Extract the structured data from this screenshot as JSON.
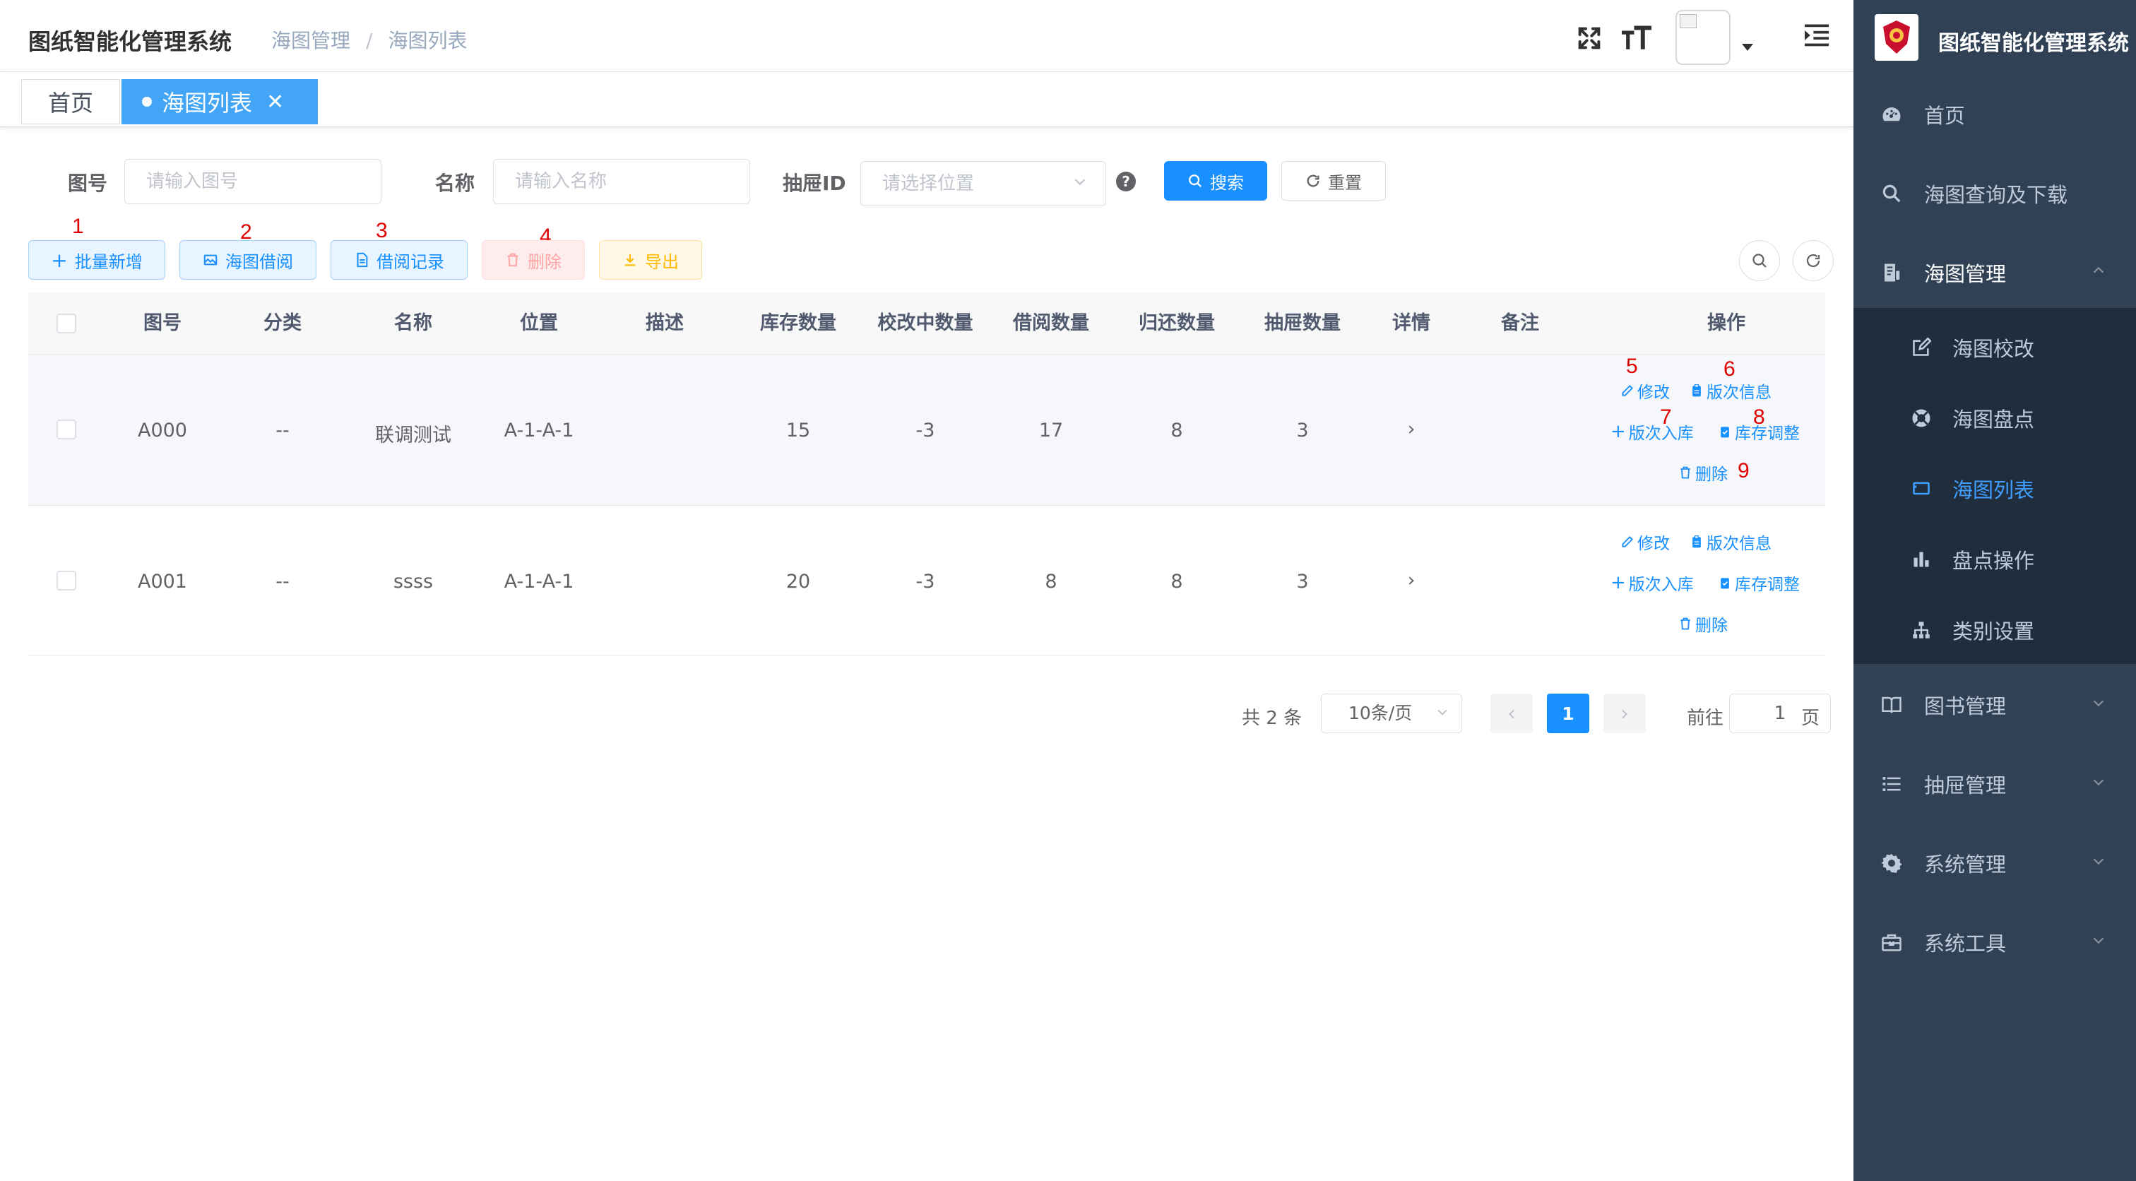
{
  "header": {
    "app_title": "图纸智能化管理系统",
    "breadcrumb": [
      "海图管理",
      "海图列表"
    ],
    "breadcrumb_sep": "/"
  },
  "tags": [
    {
      "label": "首页",
      "active": false
    },
    {
      "label": "海图列表",
      "active": true
    }
  ],
  "search": {
    "chart_no_label": "图号",
    "chart_no_placeholder": "请输入图号",
    "name_label": "名称",
    "name_placeholder": "请输入名称",
    "drawer_label": "抽屉ID",
    "drawer_placeholder": "请选择位置",
    "search_button": "搜索",
    "reset_button": "重置"
  },
  "toolbar": {
    "batch_add": "批量新增",
    "borrow": "海图借阅",
    "borrow_records": "借阅记录",
    "delete": "删除",
    "export": "导出"
  },
  "annotations": [
    "1",
    "2",
    "3",
    "4",
    "5",
    "6",
    "7",
    "8",
    "9"
  ],
  "table": {
    "columns": [
      "图号",
      "分类",
      "名称",
      "位置",
      "描述",
      "库存数量",
      "校改中数量",
      "借阅数量",
      "归还数量",
      "抽屉数量",
      "详情",
      "备注",
      "操作"
    ],
    "rows": [
      {
        "chart_no": "A000",
        "category": "--",
        "name": "联调测试",
        "location": "A-1-A-1",
        "description": "",
        "stock": "15",
        "correcting": "-3",
        "borrowed": "17",
        "returned": "8",
        "drawers": "3",
        "remark": ""
      },
      {
        "chart_no": "A001",
        "category": "--",
        "name": "ssss",
        "location": "A-1-A-1",
        "description": "",
        "stock": "20",
        "correcting": "-3",
        "borrowed": "8",
        "returned": "8",
        "drawers": "3",
        "remark": ""
      }
    ],
    "row_actions": {
      "edit": "修改",
      "version_info": "版次信息",
      "version_in": "版次入库",
      "stock_adjust": "库存调整",
      "delete": "删除"
    }
  },
  "pagination": {
    "total": "共 2 条",
    "page_size": "10条/页",
    "current_page": "1",
    "goto_label": "前往",
    "goto_value": "1",
    "page_suffix": "页"
  },
  "sidebar": {
    "title": "图纸智能化管理系统",
    "items": [
      {
        "label": "首页",
        "icon": "dashboard-icon"
      },
      {
        "label": "海图查询及下载",
        "icon": "search-icon"
      },
      {
        "label": "海图管理",
        "icon": "documentation-icon",
        "expanded": true,
        "children": [
          {
            "label": "海图校改",
            "icon": "edit-icon"
          },
          {
            "label": "海图盘点",
            "icon": "lifebuoy-icon"
          },
          {
            "label": "海图列表",
            "icon": "monitor-icon",
            "active": true
          },
          {
            "label": "盘点操作",
            "icon": "bar-chart-icon"
          },
          {
            "label": "类别设置",
            "icon": "tree-icon"
          }
        ]
      },
      {
        "label": "图书管理",
        "icon": "book-icon"
      },
      {
        "label": "抽屉管理",
        "icon": "list-icon"
      },
      {
        "label": "系统管理",
        "icon": "gear-icon"
      },
      {
        "label": "系统工具",
        "icon": "toolbox-icon"
      }
    ]
  },
  "colors": {
    "primary": "#1890ff",
    "sidebar_bg": "#304156",
    "submenu_bg": "#1f2d3d",
    "active_menu": "#409eff",
    "annotation": "#e00000"
  }
}
